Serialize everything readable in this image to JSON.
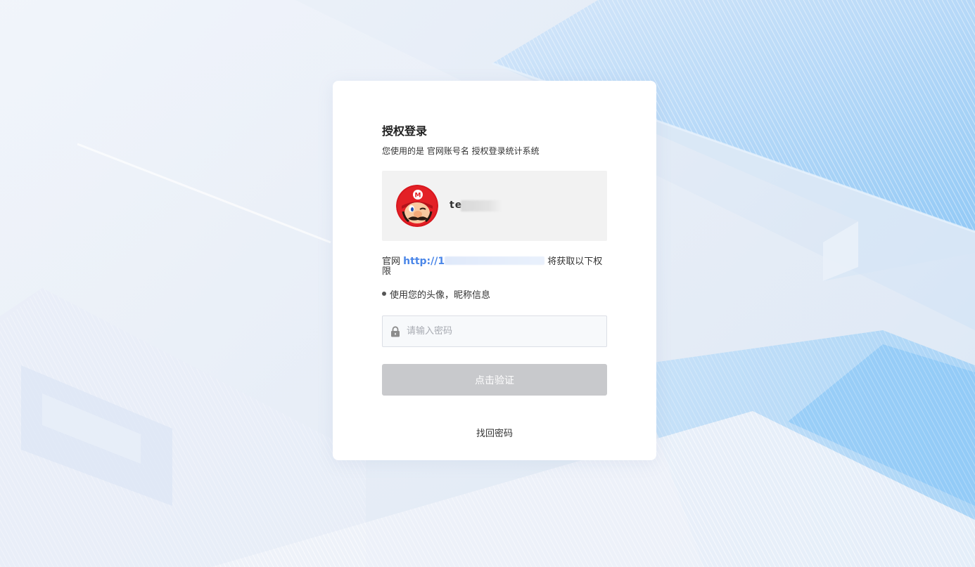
{
  "card": {
    "title": "授权登录",
    "subtitle": "您使用的是 官网账号名 授权登录统计系统"
  },
  "user": {
    "name_visible": "te",
    "avatar_icon": "mario-avatar"
  },
  "permission": {
    "prefix": "官网",
    "link_visible": "http://1",
    "suffix": "将获取以下权限",
    "items": [
      "使用您的头像，昵称信息"
    ]
  },
  "password": {
    "placeholder": "请输入密码",
    "icon": "lock-icon"
  },
  "verify_button": {
    "label": "点击验证",
    "disabled_color": "#c8c9cc"
  },
  "recover_link": {
    "label": "找回密码"
  },
  "colors": {
    "link": "#4a86e8",
    "card_bg": "#ffffff",
    "user_box_bg": "#f2f2f2"
  }
}
